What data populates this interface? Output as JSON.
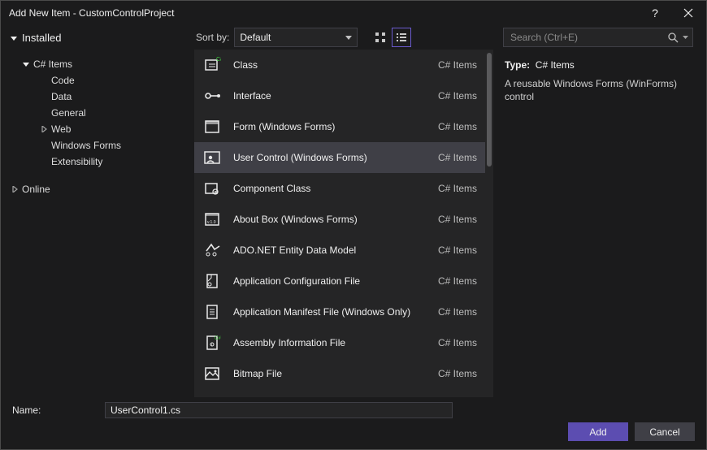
{
  "window": {
    "title": "Add New Item - CustomControlProject"
  },
  "tree": {
    "header": "Installed",
    "nodes": [
      {
        "label": "C# Items",
        "arrow": "down",
        "level": 1
      },
      {
        "label": "Code",
        "arrow": "none",
        "level": 2
      },
      {
        "label": "Data",
        "arrow": "none",
        "level": 2
      },
      {
        "label": "General",
        "arrow": "none",
        "level": 2
      },
      {
        "label": "Web",
        "arrow": "right",
        "level": 2
      },
      {
        "label": "Windows Forms",
        "arrow": "none",
        "level": 2
      },
      {
        "label": "Extensibility",
        "arrow": "none",
        "level": 2
      }
    ],
    "online": "Online"
  },
  "sort": {
    "label": "Sort by:",
    "value": "Default"
  },
  "search": {
    "placeholder": "Search (Ctrl+E)"
  },
  "items": [
    {
      "name": "Class",
      "cat": "C# Items",
      "icon": "class",
      "selected": false
    },
    {
      "name": "Interface",
      "cat": "C# Items",
      "icon": "interface",
      "selected": false
    },
    {
      "name": "Form (Windows Forms)",
      "cat": "C# Items",
      "icon": "form",
      "selected": false
    },
    {
      "name": "User Control (Windows Forms)",
      "cat": "C# Items",
      "icon": "usercontrol",
      "selected": true
    },
    {
      "name": "Component Class",
      "cat": "C# Items",
      "icon": "component",
      "selected": false
    },
    {
      "name": "About Box (Windows Forms)",
      "cat": "C# Items",
      "icon": "aboutbox",
      "selected": false
    },
    {
      "name": "ADO.NET Entity Data Model",
      "cat": "C# Items",
      "icon": "ado",
      "selected": false
    },
    {
      "name": "Application Configuration File",
      "cat": "C# Items",
      "icon": "appconfig",
      "selected": false
    },
    {
      "name": "Application Manifest File (Windows Only)",
      "cat": "C# Items",
      "icon": "manifest",
      "selected": false
    },
    {
      "name": "Assembly Information File",
      "cat": "C# Items",
      "icon": "assembly",
      "selected": false
    },
    {
      "name": "Bitmap File",
      "cat": "C# Items",
      "icon": "bitmap",
      "selected": false
    }
  ],
  "details": {
    "type_label": "Type:",
    "type_value": "C# Items",
    "description": "A reusable Windows Forms (WinForms) control"
  },
  "name_field": {
    "label": "Name:",
    "value": "UserControl1.cs"
  },
  "buttons": {
    "add": "Add",
    "cancel": "Cancel"
  }
}
